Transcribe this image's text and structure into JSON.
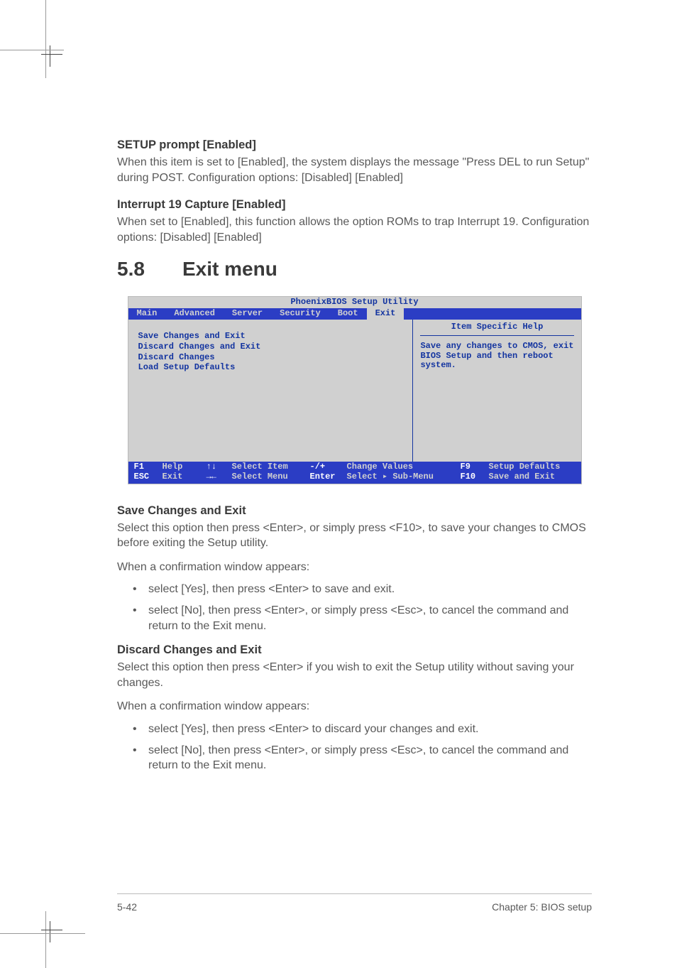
{
  "sections": {
    "setup_prompt": {
      "heading": "SETUP prompt [Enabled]",
      "body": "When this item is set to [Enabled], the system displays the message \"Press DEL to run Setup\" during POST. Configuration options: [Disabled] [Enabled]"
    },
    "int19": {
      "heading": "Interrupt 19 Capture [Enabled]",
      "body": "When set to [Enabled], this function allows the option ROMs to trap Interrupt 19. Configuration options: [Disabled] [Enabled]"
    },
    "main_heading_num": "5.8",
    "main_heading_text": "Exit menu",
    "save_exit": {
      "heading": "Save Changes and Exit",
      "p1": "Select this option then press <Enter>, or simply press <F10>, to save your changes to CMOS before exiting the Setup utility.",
      "p2": "When a confirmation window appears:",
      "li1": "select [Yes], then press <Enter> to save and exit.",
      "li2": "select [No], then press <Enter>, or simply press <Esc>, to cancel the command and return to the Exit menu."
    },
    "discard_exit": {
      "heading": "Discard Changes and Exit",
      "p1": "Select this option then press <Enter> if you wish to exit the Setup utility without saving your changes.",
      "p2": "When a confirmation window appears:",
      "li1": "select [Yes], then press <Enter> to discard your changes and exit.",
      "li2": "select [No], then press <Enter>, or simply press <Esc>, to cancel the command and return to the Exit menu."
    }
  },
  "bios": {
    "title": "PhoenixBIOS Setup Utility",
    "tabs": [
      "Main",
      "Advanced",
      "Server",
      "Security",
      "Boot",
      "Exit"
    ],
    "active_tab": "Exit",
    "menu_items": [
      "Save Changes and Exit",
      "Discard Changes and Exit",
      "Discard Changes",
      "Load Setup Defaults"
    ],
    "help_title": "Item Specific Help",
    "help_body": "Save any changes to CMOS, exit BIOS Setup and then reboot system.",
    "footer": {
      "row1": {
        "k1": "F1",
        "l1": "Help",
        "s1": "↑↓",
        "a1": "Select Item",
        "k2": "-/+",
        "v2": "Change Values",
        "k3": "F9",
        "v3": "Setup Defaults"
      },
      "row2": {
        "k1": "ESC",
        "l1": "Exit",
        "s1": "→←",
        "a1": "Select Menu",
        "k2": "Enter",
        "v2": "Select ▸ Sub-Menu",
        "k3": "F10",
        "v3": "Save and Exit"
      }
    }
  },
  "footer": {
    "left": "5-42",
    "right": "Chapter 5: BIOS setup"
  }
}
